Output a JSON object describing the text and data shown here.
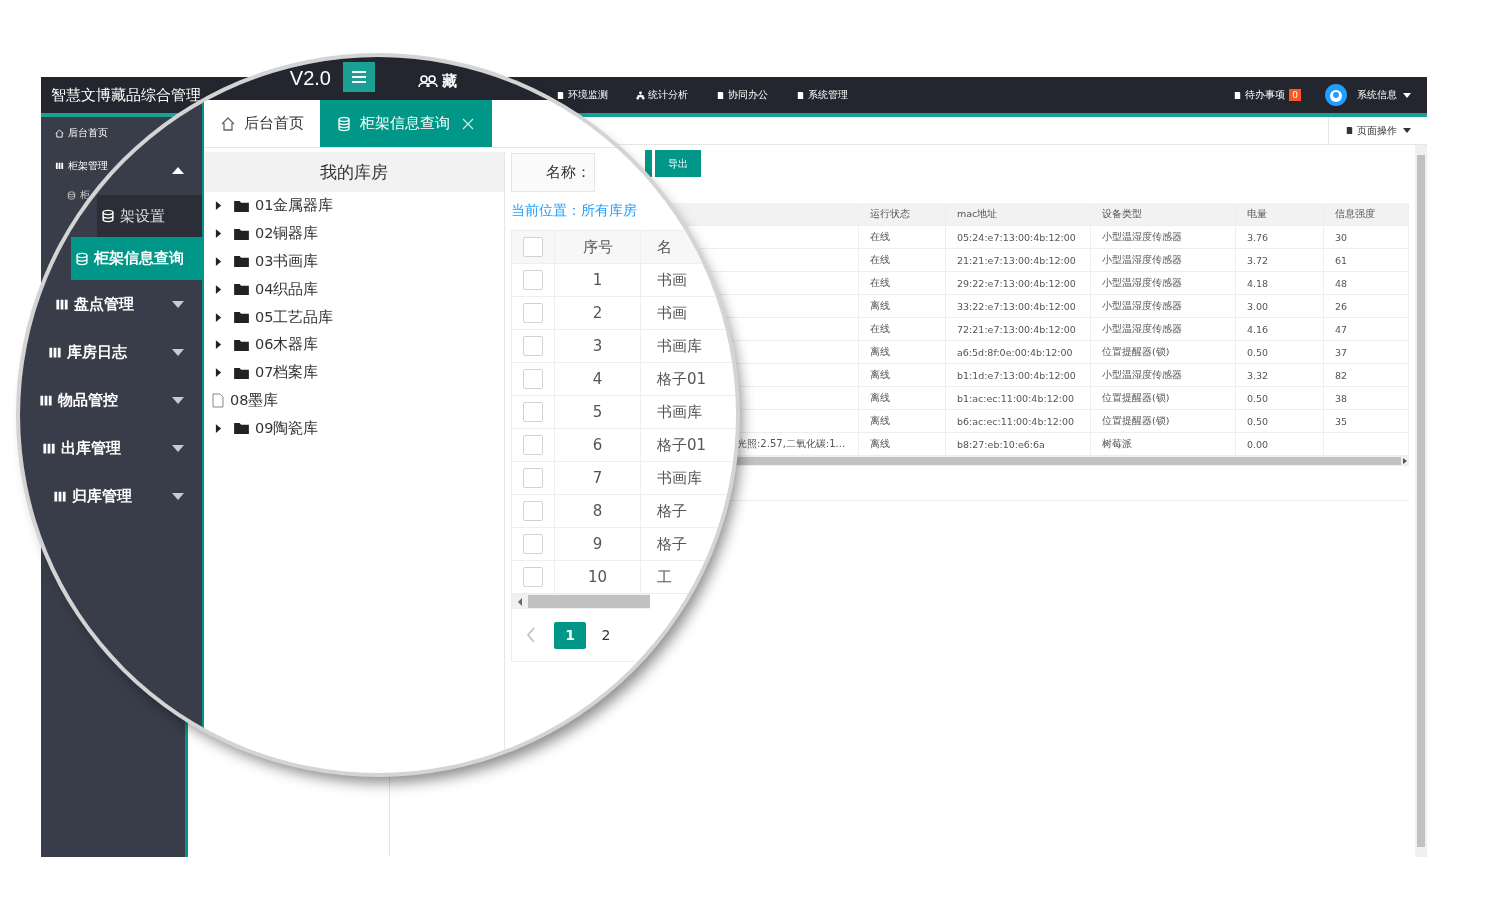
{
  "base": {
    "app_title": "智慧文博藏品综合管理",
    "top_nav": [
      {
        "label": "环境监测",
        "kind": "doc"
      },
      {
        "label": "统计分析",
        "kind": "tree"
      },
      {
        "label": "协同办公",
        "kind": "doc"
      },
      {
        "label": "系统管理",
        "kind": "doc"
      }
    ],
    "todo": {
      "label": "待办事项",
      "count": "0"
    },
    "user_menu": "系统信息",
    "page_actions": "页面操作",
    "sidebar": [
      {
        "label": "后台首页",
        "kind": "home"
      },
      {
        "label": "柜架管理",
        "kind": "group"
      },
      {
        "label": "柜",
        "kind": "sub"
      }
    ],
    "buttons": [
      {
        "kind": "query"
      },
      {
        "kind": "export",
        "label": "导出"
      }
    ],
    "table": {
      "columns": [
        "运行状态",
        "mac地址",
        "设备类型",
        "电量",
        "信息强度"
      ],
      "rows": [
        {
          "cells": [
            "在线",
            "05:24:e7:13:00:4b:12:00",
            "小型温湿度传感器",
            "3.76",
            "30"
          ]
        },
        {
          "cells": [
            "在线",
            "21:21:e7:13:00:4b:12:00",
            "小型温湿度传感器",
            "3.72",
            "61"
          ]
        },
        {
          "cells": [
            "在线",
            "29:22:e7:13:00:4b:12:00",
            "小型温湿度传感器",
            "4.18",
            "48"
          ]
        },
        {
          "cells": [
            "离线",
            "33:22:e7:13:00:4b:12:00",
            "小型温湿度传感器",
            "3.00",
            "26"
          ]
        },
        {
          "cells": [
            "在线",
            "72:21:e7:13:00:4b:12:00",
            "小型温湿度传感器",
            "4.16",
            "47"
          ]
        },
        {
          "cells": [
            "离线",
            "a6:5d:8f:0e:00:4b:12:00",
            "位置提醒器(锁)",
            "0.50",
            "37"
          ]
        },
        {
          "cells": [
            "离线",
            "b1:1d:e7:13:00:4b:12:00",
            "小型温湿度传感器",
            "3.32",
            "82"
          ]
        },
        {
          "cells": [
            "离线",
            "b1:ac:ec:11:00:4b:12:00",
            "位置提醒器(锁)",
            "0.50",
            "38"
          ]
        },
        {
          "cells": [
            "离线",
            "b6:ac:ec:11:00:4b:12:00",
            "位置提醒器(锁)",
            "0.50",
            "35"
          ]
        },
        {
          "extra": "光照:2.57,二氧化碳:1...",
          "cells": [
            "离线",
            "b8:27:eb:10:e6:6a",
            "树莓派",
            "0.00"
          ]
        }
      ]
    }
  },
  "magnifier": {
    "app_title": "V2.0",
    "module": "藏",
    "tabs": [
      {
        "label": "后台首页",
        "kind": "home",
        "selected": false
      },
      {
        "label": "柜架信息查询",
        "kind": "db",
        "selected": true
      }
    ],
    "sidebar": [
      {
        "kind": "group",
        "expanded": true
      },
      {
        "label": "架设置",
        "kind": "sub",
        "selected": false
      },
      {
        "label": "柜架信息查询",
        "kind": "sub",
        "selected": true
      },
      {
        "label": "盘点管理",
        "kind": "group",
        "expanded": false
      },
      {
        "label": "库房日志",
        "kind": "group",
        "expanded": false
      },
      {
        "label": "物品管控",
        "kind": "group",
        "expanded": false
      },
      {
        "label": "出库管理",
        "kind": "group",
        "expanded": false
      },
      {
        "label": "归库管理",
        "kind": "group",
        "expanded": false
      }
    ],
    "tree": {
      "title": "我的库房",
      "items": [
        {
          "label": "01金属器库",
          "kind": "folder"
        },
        {
          "label": "02铜器库",
          "kind": "folder"
        },
        {
          "label": "03书画库",
          "kind": "folder"
        },
        {
          "label": "04织品库",
          "kind": "folder"
        },
        {
          "label": "05工艺品库",
          "kind": "folder"
        },
        {
          "label": "06木器库",
          "kind": "folder"
        },
        {
          "label": "07档案库",
          "kind": "folder"
        },
        {
          "label": "08墨库",
          "kind": "file"
        },
        {
          "label": "09陶瓷库",
          "kind": "folder"
        }
      ]
    },
    "search_label": "名称：",
    "breadcrumb": "当前位置：所有库房",
    "table": {
      "columns": [
        "序号",
        "名"
      ],
      "header_checked": false,
      "rows": [
        {
          "index": "1",
          "name": "书画",
          "checked": false
        },
        {
          "index": "2",
          "name": "书画",
          "checked": false
        },
        {
          "index": "3",
          "name": "书画库",
          "checked": false
        },
        {
          "index": "4",
          "name": "格子01",
          "checked": false
        },
        {
          "index": "5",
          "name": "书画库",
          "checked": false
        },
        {
          "index": "6",
          "name": "格子01",
          "checked": false
        },
        {
          "index": "7",
          "name": "书画库",
          "checked": false
        },
        {
          "index": "8",
          "name": "格子",
          "checked": false
        },
        {
          "index": "9",
          "name": "格子",
          "checked": false
        },
        {
          "index": "10",
          "name": "工",
          "checked": false
        }
      ]
    },
    "pagination": [
      {
        "label": "1",
        "selected": true
      },
      {
        "label": "2",
        "selected": false
      }
    ]
  }
}
